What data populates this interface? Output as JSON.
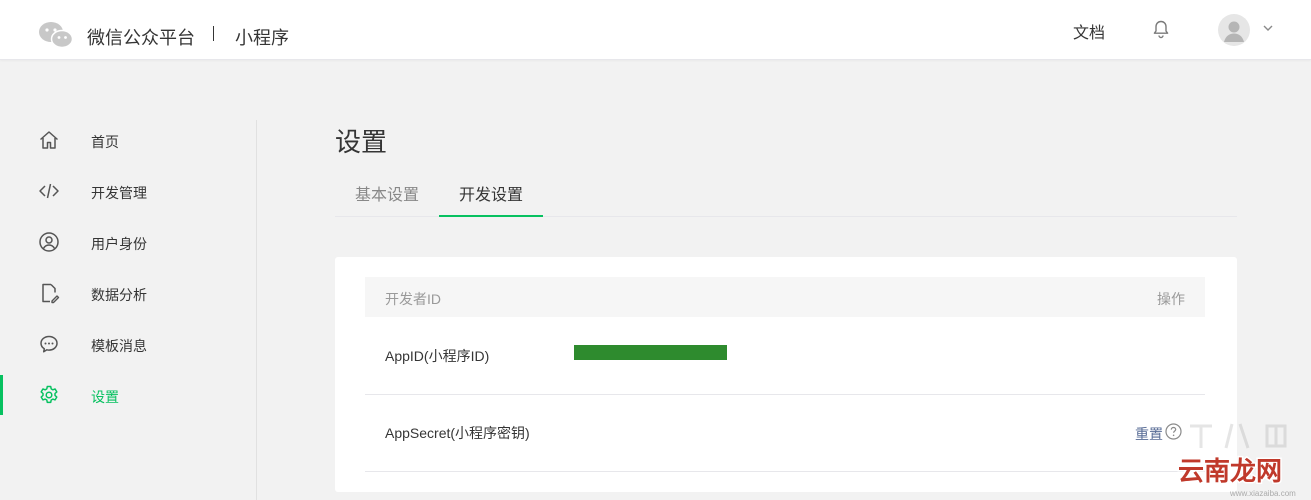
{
  "header": {
    "brand": "微信公众平台",
    "product": "小程序",
    "doc_link": "文档"
  },
  "sidebar": {
    "items": [
      {
        "label": "首页",
        "icon": "home-icon"
      },
      {
        "label": "开发管理",
        "icon": "code-icon"
      },
      {
        "label": "用户身份",
        "icon": "user-icon"
      },
      {
        "label": "数据分析",
        "icon": "data-analysis-icon"
      },
      {
        "label": "模板消息",
        "icon": "message-icon"
      },
      {
        "label": "设置",
        "icon": "gear-icon",
        "active": true
      }
    ]
  },
  "main": {
    "title": "设置",
    "tabs": [
      {
        "label": "基本设置"
      },
      {
        "label": "开发设置",
        "active": true
      }
    ],
    "table": {
      "headers": [
        "开发者ID",
        "操作"
      ],
      "rows": [
        {
          "label": "AppID(小程序ID)",
          "value": "[已遮挡]",
          "action": ""
        },
        {
          "label": "AppSecret(小程序密钥)",
          "value": "",
          "action": "重置"
        }
      ]
    }
  },
  "watermark": {
    "text": "云南龙网",
    "domain": "www.xiazaiba.com"
  },
  "colors": {
    "accent": "#07c160",
    "link": "#576b95",
    "masked": "#2e8b2e"
  }
}
